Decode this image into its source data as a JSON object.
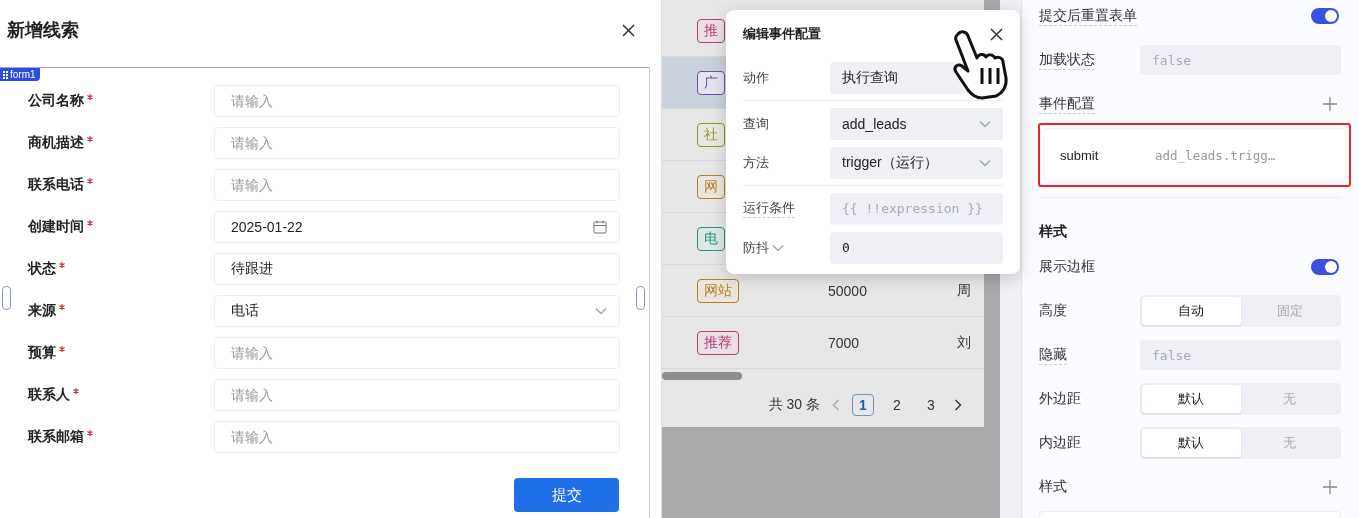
{
  "dialog": {
    "title": "新增线索",
    "form_tag": "form1",
    "fields": [
      {
        "label": "公司名称",
        "required": true,
        "kind": "text",
        "placeholder": "请输入"
      },
      {
        "label": "商机描述",
        "required": true,
        "kind": "text",
        "placeholder": "请输入"
      },
      {
        "label": "联系电话",
        "required": true,
        "kind": "text",
        "placeholder": "请输入"
      },
      {
        "label": "创建时间",
        "required": true,
        "kind": "date",
        "value": "2025-01-22"
      },
      {
        "label": "状态",
        "required": true,
        "kind": "text",
        "value": "待跟进"
      },
      {
        "label": "来源",
        "required": true,
        "kind": "select",
        "value": "电话"
      },
      {
        "label": "预算",
        "required": true,
        "kind": "text",
        "placeholder": "请输入"
      },
      {
        "label": "联系人",
        "required": true,
        "kind": "text",
        "placeholder": "请输入"
      },
      {
        "label": "联系邮箱",
        "required": true,
        "kind": "text",
        "placeholder": "请输入"
      }
    ],
    "submit": "提交"
  },
  "table": {
    "rows": [
      {
        "tag": "推",
        "color": "#b0407a",
        "selected": false
      },
      {
        "tag": "广",
        "color": "#6a54a8",
        "selected": true
      },
      {
        "tag": "社",
        "color": "#9a9430",
        "selected": false
      },
      {
        "tag": "网",
        "color": "#b0802a",
        "selected": false
      },
      {
        "tag": "电",
        "color": "#2e9080",
        "selected": false
      },
      {
        "tag": "网站",
        "color": "#b0802a",
        "amount": "50000",
        "column_3": "周",
        "selected": false
      },
      {
        "tag": "推荐",
        "color": "#b0407a",
        "amount": "7000",
        "column_3": "刘",
        "selected": false
      }
    ],
    "pagination": {
      "total": "共 30 条",
      "pages": [
        {
          "label": "1",
          "selected": true
        },
        {
          "label": "2",
          "selected": false
        },
        {
          "label": "3",
          "selected": false
        }
      ]
    }
  },
  "popup": {
    "title": "编辑事件配置",
    "rows": [
      {
        "label": "动作",
        "kind": "text",
        "value": "执行查询",
        "group_start": false,
        "hint": false,
        "menu": false
      },
      {
        "label": "查询",
        "kind": "select",
        "value": "add_leads",
        "group_start": true,
        "hint": false,
        "menu": false
      },
      {
        "label": "方法",
        "kind": "select",
        "value": "trigger（运行）",
        "group_start": false,
        "hint": false,
        "menu": false
      },
      {
        "label": "运行条件",
        "kind": "code",
        "placeholder": "{{ !!expression }}",
        "group_start": true,
        "hint": true,
        "menu": false
      },
      {
        "label": "防抖",
        "kind": "code",
        "value": "0",
        "group_start": false,
        "hint": false,
        "menu": true
      }
    ]
  },
  "panel": {
    "items": [
      {
        "kind": "toggle",
        "label": "提交后重置表单",
        "hint": true,
        "on": true
      },
      {
        "kind": "code",
        "label": "加载状态",
        "hint": true,
        "placeholder": "false"
      },
      {
        "kind": "add",
        "label": "事件配置",
        "hint": true
      },
      {
        "kind": "event",
        "name": "submit",
        "action": "add_leads.trigg…",
        "highlighted": true
      },
      {
        "kind": "heading",
        "label": "样式"
      },
      {
        "kind": "toggle",
        "label": "展示边框",
        "hint": false,
        "on": true
      },
      {
        "kind": "segmented",
        "label": "高度",
        "hint": false,
        "options": [
          {
            "label": "自动",
            "selected": true
          },
          {
            "label": "固定",
            "selected": false
          }
        ]
      },
      {
        "kind": "code",
        "label": "隐藏",
        "hint": true,
        "placeholder": "false"
      },
      {
        "kind": "segmented",
        "label": "外边距",
        "hint": false,
        "options": [
          {
            "label": "默认",
            "selected": true
          },
          {
            "label": "无",
            "selected": false
          }
        ]
      },
      {
        "kind": "segmented",
        "label": "内边距",
        "hint": false,
        "options": [
          {
            "label": "默认",
            "selected": true
          },
          {
            "label": "无",
            "selected": false
          }
        ]
      },
      {
        "kind": "add",
        "label": "样式",
        "hint": false
      },
      {
        "kind": "entry"
      }
    ]
  }
}
